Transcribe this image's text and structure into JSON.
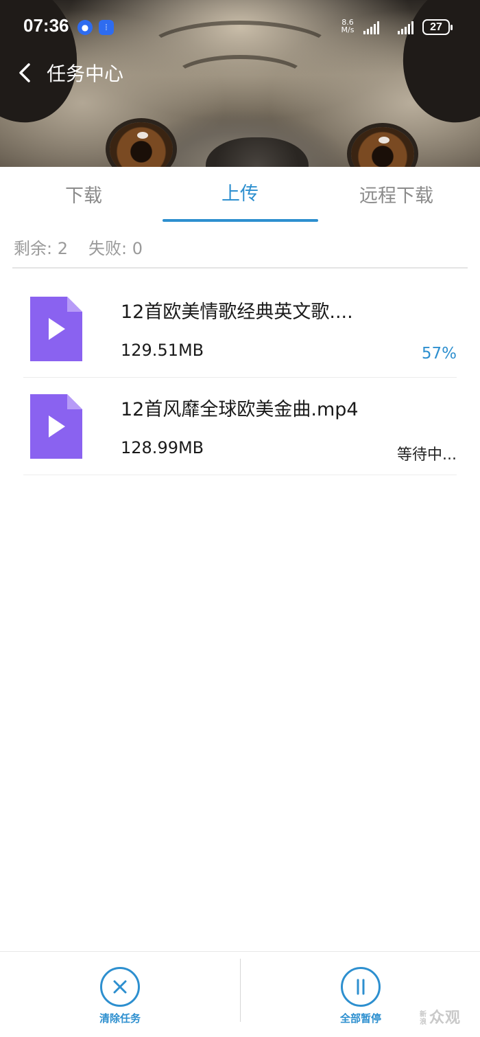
{
  "status_bar": {
    "time": "07:36",
    "speed_value": "8.6",
    "speed_unit": "M/s",
    "battery": "27"
  },
  "header": {
    "title": "任务中心"
  },
  "tabs": [
    {
      "label": "下载",
      "active": false
    },
    {
      "label": "上传",
      "active": true
    },
    {
      "label": "远程下载",
      "active": false
    }
  ],
  "summary": {
    "remaining": "剩余: 2",
    "failed": "失败: 0"
  },
  "tasks": [
    {
      "name": "12首欧美情歌经典英文歌....",
      "size": "129.51MB",
      "status": "57%",
      "progress": 0.57
    },
    {
      "name": "12首风靡全球欧美金曲.mp4",
      "size": "128.99MB",
      "status": "等待中..."
    }
  ],
  "bottom_bar": {
    "clear_label": "清除任务",
    "pause_label": "全部暂停"
  },
  "watermark": {
    "text": "众观",
    "small": "新浪"
  },
  "colors": {
    "accent": "#2d8fcf",
    "file_icon": "#8a62f0",
    "file_icon_fold": "#b79bf7"
  }
}
